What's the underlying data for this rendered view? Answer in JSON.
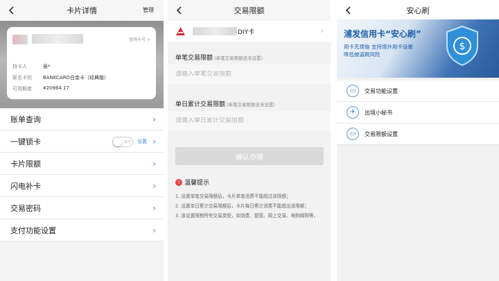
{
  "colors": {
    "accent_blue": "#3b8fd8",
    "tip_red": "#e6434b",
    "button_disabled": "#d9d9d9",
    "bank_red": "#d9262c"
  },
  "panel1": {
    "back_icon": "chevron-left-icon",
    "title": "卡片详情",
    "manage_label": "管理",
    "card": {
      "query_label": "查询卡号 >",
      "holder_label": "持卡人",
      "holder_value": "吴*",
      "product_label": "联名卡别",
      "product_value": "BANKCARD白金卡（经典版）",
      "limit_label": "可用额度",
      "limit_value": "¥20964.17"
    },
    "menu": [
      {
        "label": "账单查询"
      },
      {
        "label": "一键锁卡",
        "toggle_text": "锁卡",
        "link_label": "设置"
      },
      {
        "label": "卡片限额"
      },
      {
        "label": "闪电补卡"
      },
      {
        "label": "交易密码"
      },
      {
        "label": "支付功能设置"
      }
    ]
  },
  "panel2": {
    "title": "交易限额",
    "card_name": "DIY卡",
    "single": {
      "title": "单笔交易限额",
      "hint": "(单笔交易限额还未设置)",
      "placeholder": "请输入单笔交易限额"
    },
    "daily": {
      "title": "单日累计交易限额",
      "hint": "(单笔交易限额还未设置)",
      "placeholder": "请输入单日累计交易限额"
    },
    "confirm_label": "确认办理",
    "tips_title": "温馨提示",
    "tips": [
      "1. 设置单笔交易限额后，卡片单笔消费不能超过该限额；",
      "2. 设置单日累计交易限额后，卡片每日累计消费不能超出该限额；",
      "3. 该设置限制所有交易类型，如消费、提现、网上交易、电购邮购等。"
    ]
  },
  "panel3": {
    "title": "安心刷",
    "banner": {
      "headline": "浦发信用卡“安心刷”",
      "line1": "用卡无烦恼 支持境外用卡设置",
      "line2": "降低被盗刷风险"
    },
    "items": [
      {
        "label": "交易功能设置",
        "icon": "card-icon"
      },
      {
        "label": "出境小秘书",
        "icon": "plane-icon"
      },
      {
        "label": "交易限额设置",
        "icon": "card-icon"
      }
    ]
  }
}
